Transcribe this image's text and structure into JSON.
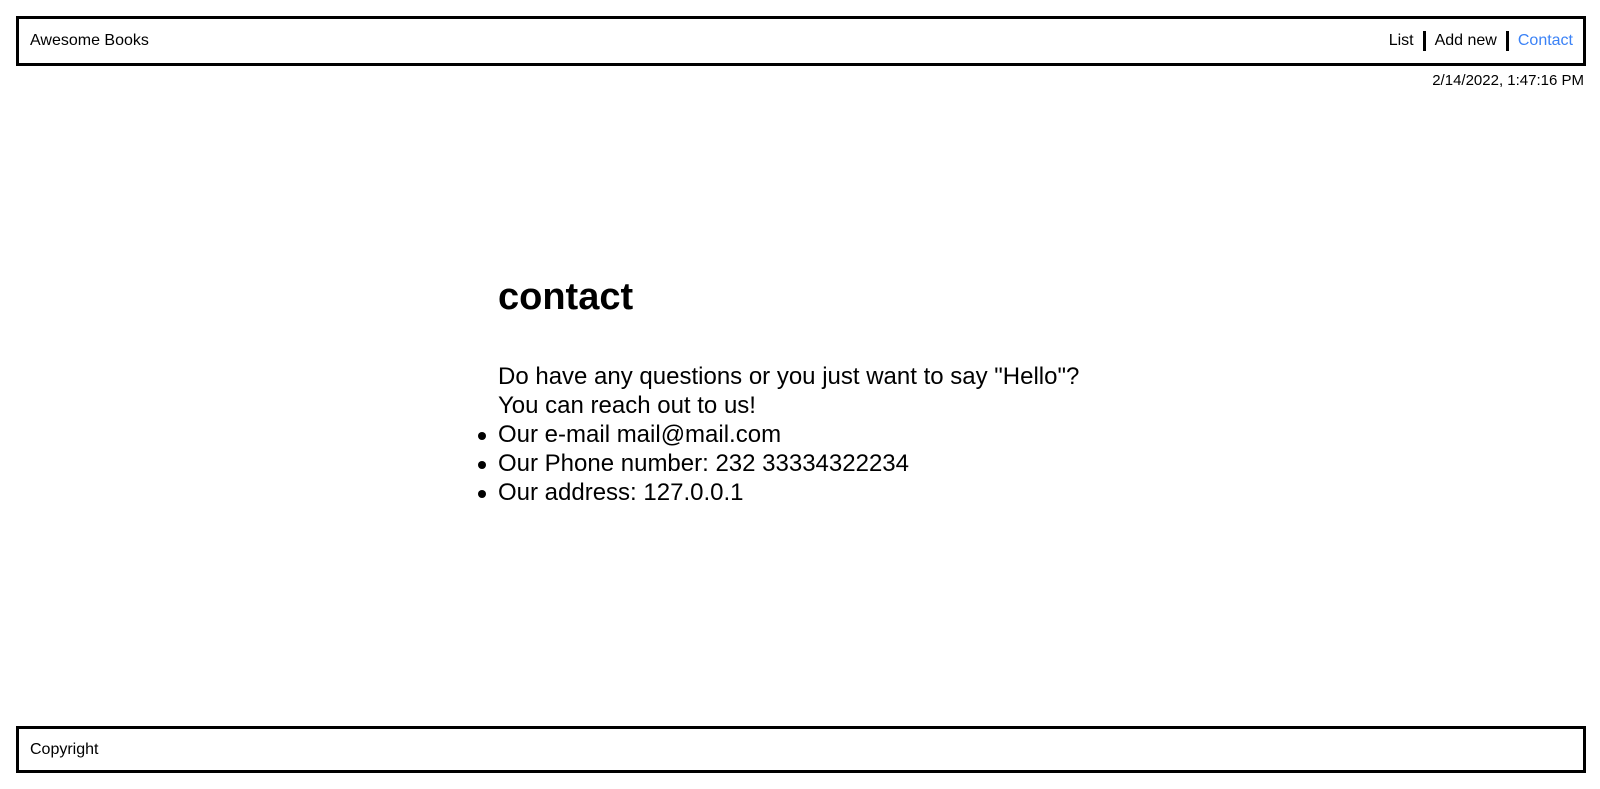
{
  "header": {
    "brand": "Awesome Books",
    "nav": {
      "list": "List",
      "add_new": "Add new",
      "contact": "Contact"
    },
    "active_color": "#3b82f6"
  },
  "datetime": "2/14/2022, 1:47:16 PM",
  "contact": {
    "title": "contact",
    "intro_line1": "Do have any questions or you just want to say \"Hello\"?",
    "intro_line2": "You can reach out to us!",
    "items": [
      "Our e-mail mail@mail.com",
      "Our Phone number: 232 33334322234",
      "Our address: 127.0.0.1"
    ]
  },
  "footer": {
    "text": "Copyright"
  }
}
